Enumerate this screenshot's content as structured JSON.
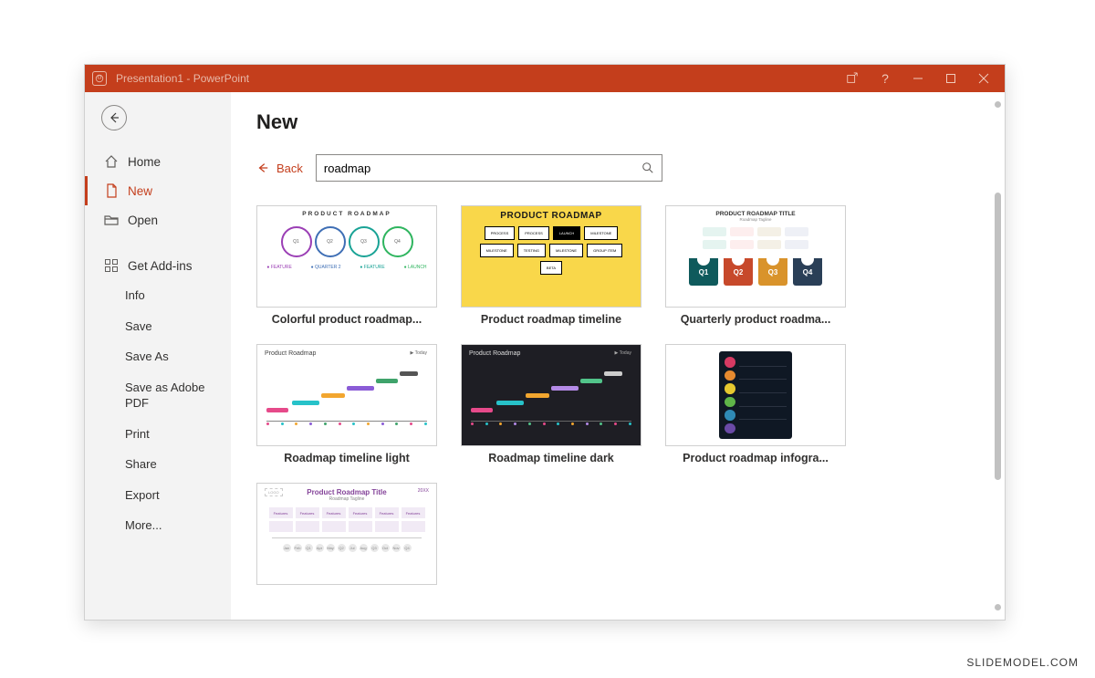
{
  "titlebar": {
    "title": "Presentation1 - PowerPoint"
  },
  "sidebar": {
    "top": [
      {
        "key": "home",
        "label": "Home",
        "icon": "home"
      },
      {
        "key": "new",
        "label": "New",
        "icon": "page",
        "active": true
      },
      {
        "key": "open",
        "label": "Open",
        "icon": "folder"
      }
    ],
    "addins": {
      "label": "Get Add-ins",
      "icon": "grid"
    },
    "sub": [
      {
        "key": "info",
        "label": "Info"
      },
      {
        "key": "save",
        "label": "Save"
      },
      {
        "key": "saveas",
        "label": "Save As"
      },
      {
        "key": "savepdf",
        "label": "Save as Adobe PDF"
      },
      {
        "key": "print",
        "label": "Print"
      },
      {
        "key": "share",
        "label": "Share"
      },
      {
        "key": "export",
        "label": "Export"
      },
      {
        "key": "more",
        "label": "More..."
      }
    ]
  },
  "content": {
    "page_title": "New",
    "back_label": "Back",
    "search_value": "roadmap",
    "templates": [
      {
        "label": "Colorful product roadmap..."
      },
      {
        "label": "Product roadmap timeline"
      },
      {
        "label": "Quarterly product roadma..."
      },
      {
        "label": "Roadmap timeline light"
      },
      {
        "label": "Roadmap timeline dark"
      },
      {
        "label": "Product roadmap infogra..."
      },
      {
        "label": ""
      }
    ],
    "thumb_text": {
      "t1_title": "PRODUCT ROADMAP",
      "t2_title": "PRODUCT ROADMAP",
      "t3_title": "PRODUCT ROADMAP TITLE",
      "t3_sub": "Roadmap Tagline",
      "t4_title": "Product Roadmap",
      "t5_title": "Product Roadmap",
      "t7_title": "Product Roadmap Title",
      "t7_sub": "Roadmap Tagline",
      "t7_logo": "LOGO",
      "t7_year": "20XX",
      "q1": "Q1",
      "q2": "Q2",
      "q3": "Q3",
      "q4": "Q4"
    }
  },
  "watermark": "SLIDEMODEL.COM"
}
